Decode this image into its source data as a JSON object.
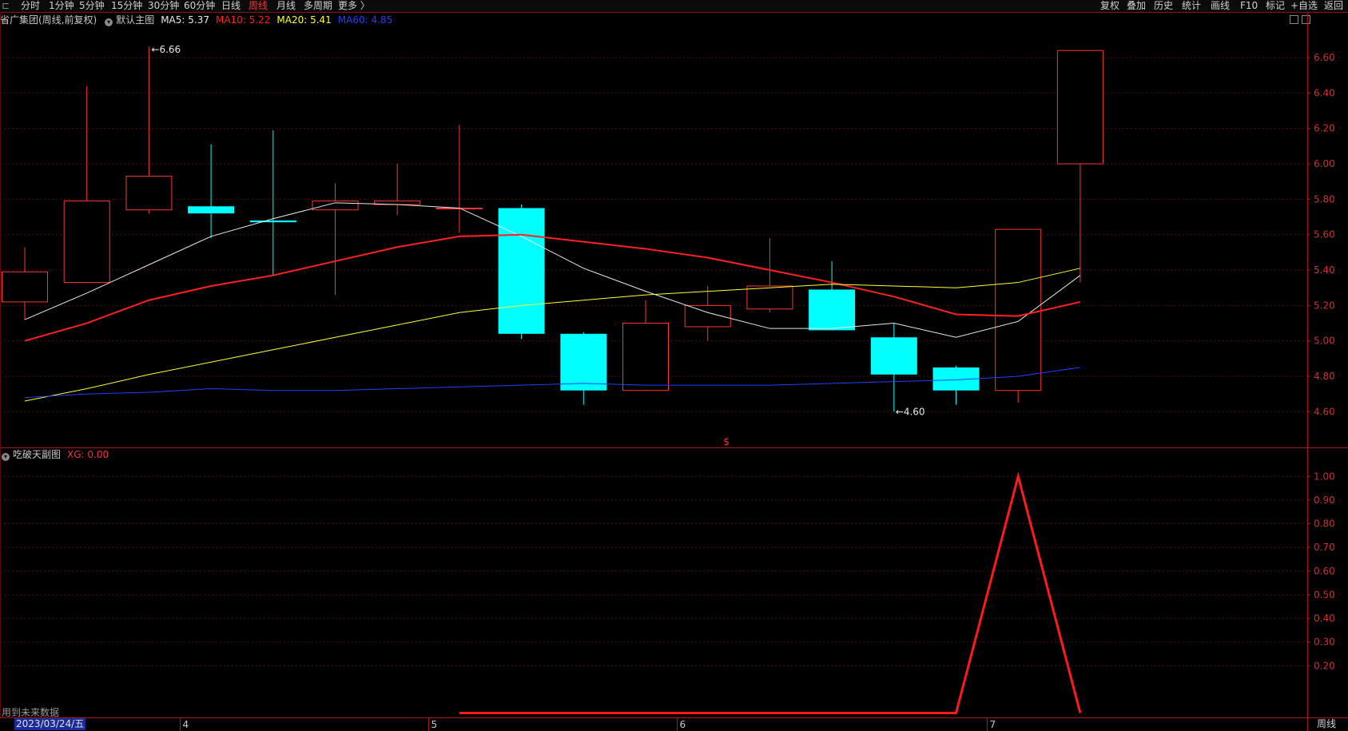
{
  "toolbar": {
    "left": [
      "分时",
      "1分钟",
      "5分钟",
      "15分钟",
      "30分钟",
      "60分钟",
      "日线",
      "周线",
      "月线",
      "多周期",
      "更多 〉"
    ],
    "active": "周线",
    "right": [
      "复权",
      "叠加",
      "历史",
      "统计",
      "画线",
      "F10",
      "标记",
      "+自选",
      "返回"
    ]
  },
  "main_panel": {
    "stock_title": "省广集团(周线,前复权)",
    "chart_name": "默认主图",
    "ma_labels": [
      {
        "text": "MA5: 5.37",
        "color": "#e8e8e8"
      },
      {
        "text": "MA10: 5.22",
        "color": "#ff2020"
      },
      {
        "text": "MA20: 5.41",
        "color": "#ffff30"
      },
      {
        "text": "MA60: 4.85",
        "color": "#2040ff"
      }
    ]
  },
  "sub_panel": {
    "name": "吃破天副图",
    "value_label": "XG: 0.00",
    "value_color": "#ff3030"
  },
  "footer": {
    "future_note": "用到未来数据",
    "date_label": "2023/03/24/五",
    "period_label": "周线"
  },
  "chart_data": [
    {
      "type": "candlestick",
      "ylim": [
        4.5,
        6.72
      ],
      "yticks": [
        "6.60",
        "6.40",
        "6.20",
        "6.00",
        "5.80",
        "5.60",
        "5.40",
        "5.20",
        "5.00",
        "4.80",
        "4.60"
      ],
      "month_labels": [
        "4",
        "5",
        "6",
        "7"
      ],
      "month_after_index": [
        2,
        6,
        10,
        15
      ],
      "marker_label": "$",
      "high_annotation": "6.66",
      "low_annotation": "4.60",
      "candles": [
        {
          "open": 5.22,
          "close": 5.39,
          "high": 5.53,
          "low": 5.12
        },
        {
          "open": 5.33,
          "close": 5.79,
          "high": 6.44,
          "low": 5.33
        },
        {
          "open": 5.74,
          "close": 5.93,
          "high": 6.66,
          "low": 5.72
        },
        {
          "open": 5.76,
          "close": 5.72,
          "high": 6.11,
          "low": 5.58
        },
        {
          "open": 5.68,
          "close": 5.67,
          "high": 6.19,
          "low": 5.37
        },
        {
          "open": 5.74,
          "close": 5.79,
          "high": 5.89,
          "low": 5.26
        },
        {
          "open": 5.77,
          "close": 5.79,
          "high": 6.0,
          "low": 5.71
        },
        {
          "open": 5.75,
          "close": 5.75,
          "high": 6.22,
          "low": 5.61
        },
        {
          "open": 5.75,
          "close": 5.04,
          "high": 5.77,
          "low": 5.01
        },
        {
          "open": 5.04,
          "close": 4.72,
          "high": 5.05,
          "low": 4.64
        },
        {
          "open": 4.72,
          "close": 5.1,
          "high": 5.23,
          "low": 4.72
        },
        {
          "open": 5.08,
          "close": 5.2,
          "high": 5.31,
          "low": 5.0
        },
        {
          "open": 5.18,
          "close": 5.31,
          "high": 5.58,
          "low": 5.16
        },
        {
          "open": 5.29,
          "close": 5.06,
          "high": 5.45,
          "low": 5.06
        },
        {
          "open": 5.02,
          "close": 4.81,
          "high": 5.1,
          "low": 4.6
        },
        {
          "open": 4.85,
          "close": 4.72,
          "high": 4.86,
          "low": 4.64
        },
        {
          "open": 4.72,
          "close": 5.63,
          "high": 5.63,
          "low": 4.65
        },
        {
          "open": 6.0,
          "close": 6.64,
          "high": 6.64,
          "low": 5.33
        }
      ],
      "ma_series": [
        {
          "name": "MA5",
          "color": "#e8e8e8",
          "values": [
            5.12,
            5.27,
            5.43,
            5.59,
            5.69,
            5.78,
            5.77,
            5.75,
            5.59,
            5.41,
            5.28,
            5.16,
            5.07,
            5.07,
            5.1,
            5.02,
            5.11,
            5.37
          ]
        },
        {
          "name": "MA10",
          "color": "#ff2020",
          "values": [
            5.0,
            5.1,
            5.23,
            5.31,
            5.37,
            5.45,
            5.53,
            5.59,
            5.6,
            5.56,
            5.52,
            5.47,
            5.4,
            5.33,
            5.25,
            5.15,
            5.14,
            5.22
          ]
        },
        {
          "name": "MA20",
          "color": "#ffff30",
          "values": [
            4.66,
            4.73,
            4.81,
            4.88,
            4.95,
            5.02,
            5.09,
            5.16,
            5.2,
            5.23,
            5.26,
            5.28,
            5.3,
            5.32,
            5.31,
            5.3,
            5.33,
            5.41
          ]
        },
        {
          "name": "MA60",
          "color": "#2040ff",
          "values": [
            4.68,
            4.7,
            4.71,
            4.73,
            4.72,
            4.72,
            4.73,
            4.74,
            4.75,
            4.76,
            4.75,
            4.75,
            4.75,
            4.76,
            4.77,
            4.78,
            4.8,
            4.85
          ]
        }
      ]
    },
    {
      "type": "line",
      "ylim": [
        0,
        1.05
      ],
      "yticks": [
        "1.00",
        "0.90",
        "0.80",
        "0.70",
        "0.60",
        "0.50",
        "0.40",
        "0.30",
        "0.20"
      ],
      "series": [
        {
          "name": "XG",
          "color": "#ff1a1a",
          "start_index": 7,
          "values": [
            0,
            0,
            0,
            0,
            0,
            0,
            0,
            0,
            0,
            1,
            0
          ]
        }
      ]
    }
  ]
}
